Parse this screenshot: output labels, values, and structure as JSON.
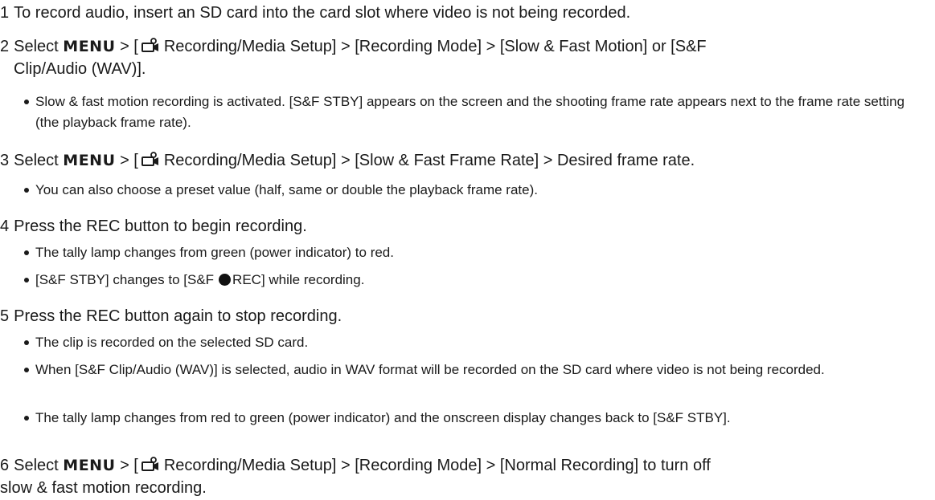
{
  "steps": [
    {
      "num": "1",
      "text": "To record audio, insert an SD card into the card slot where video is not being recorded."
    },
    {
      "num": "2",
      "pre": "Select",
      "menu": "MENU",
      "mid": "> [",
      "text": "Recording/Media Setup] > [Recording Mode] > [Slow & Fast Motion] or [S&F",
      "text2": "Clip/Audio (WAV)]."
    },
    {
      "num": "3",
      "pre": "Select",
      "menu": "MENU",
      "mid": "> [",
      "text": "Recording/Media Setup] > [Slow & Fast Frame Rate] > Desired frame rate."
    },
    {
      "num": "4",
      "text": "Press the REC button to begin recording."
    },
    {
      "num": "5",
      "text": "Press the REC button again to stop recording."
    },
    {
      "num": "6",
      "pre": "Select",
      "menu": "MENU",
      "mid": "> [",
      "text": "Recording/Media Setup] > [Recording Mode] > [Normal Recording] to turn off",
      "text2": "slow & fast motion recording."
    }
  ],
  "bullets": {
    "b2_1": "Slow & fast motion recording is activated. [S&F STBY] appears on the screen and the shooting frame rate appears next to the frame rate setting (the playback frame rate).",
    "b3_1": "You can also choose a preset value (half, same or double the playback frame rate).",
    "b4_1": "The tally lamp changes from green (power indicator) to red.",
    "b4_2_a": "[S&F STBY] changes to [S&F",
    "b4_2_b": "REC] while recording.",
    "b5_1": "The clip is recorded on the selected SD card.",
    "b5_2": "When [S&F Clip/Audio (WAV)] is selected, audio in WAV format will be recorded on the SD card where video is not being recorded.",
    "b5_3": "The tally lamp changes from red to green (power indicator) and the onscreen display changes back to [S&F STBY]."
  },
  "icons": {
    "menu_icon": "camera-setup-icon",
    "rec_dot": "record-dot-icon"
  }
}
